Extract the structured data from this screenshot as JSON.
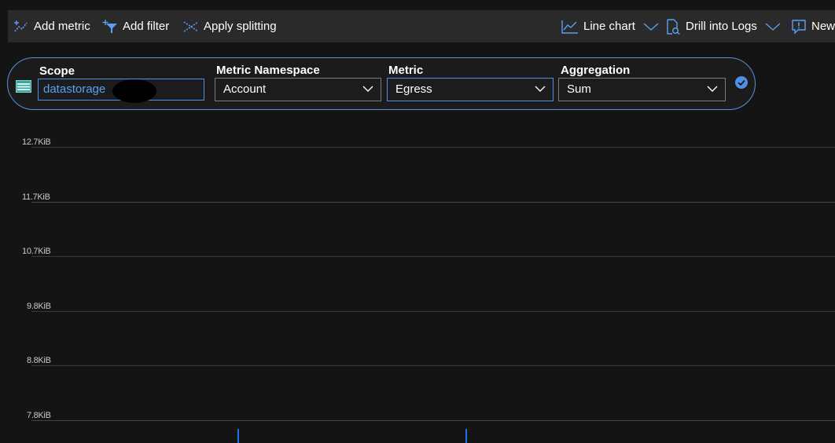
{
  "toolbar": {
    "add_metric": "Add metric",
    "add_filter": "Add filter",
    "apply_splitting": "Apply splitting",
    "line_chart": "Line chart",
    "drill_into_logs": "Drill into Logs",
    "new": "New"
  },
  "scope_bar": {
    "scope_label": "Scope",
    "scope_value": "datastorage",
    "namespace_label": "Metric Namespace",
    "namespace_value": "Account",
    "metric_label": "Metric",
    "metric_value": "Egress",
    "aggregation_label": "Aggregation",
    "aggregation_value": "Sum"
  },
  "chart": {
    "y_ticks": [
      "12.7KiB",
      "11.7KiB",
      "10.7KiB",
      "9.8KiB",
      "8.8KiB",
      "7.8KiB"
    ]
  },
  "colors": {
    "accent": "#4f8fe6",
    "icon_blue": "#5aa0f2",
    "background": "#141414",
    "toolbar": "#2a2a2a"
  }
}
